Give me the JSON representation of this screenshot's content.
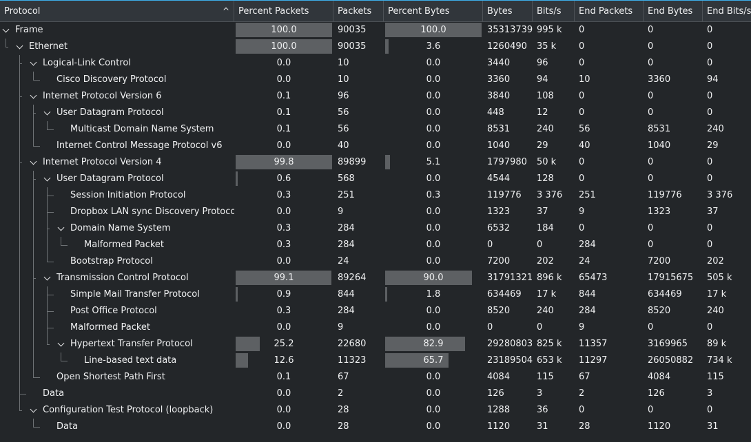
{
  "columns": [
    {
      "key": "protocol",
      "label": "Protocol"
    },
    {
      "key": "pct_packets",
      "label": "Percent Packets"
    },
    {
      "key": "packets",
      "label": "Packets"
    },
    {
      "key": "pct_bytes",
      "label": "Percent Bytes"
    },
    {
      "key": "bytes",
      "label": "Bytes"
    },
    {
      "key": "bits_s",
      "label": "Bits/s"
    },
    {
      "key": "end_packets",
      "label": "End Packets"
    },
    {
      "key": "end_bytes",
      "label": "End Bytes"
    },
    {
      "key": "end_bits_s",
      "label": "End Bits/s"
    }
  ],
  "sort_indicator": {
    "column": "protocol",
    "icon": "chevron-up-icon"
  },
  "rows": [
    {
      "depth": 0,
      "expanded": true,
      "name": "Frame",
      "pct_packets": "100.0",
      "packets": "90035",
      "pct_bytes": "100.0",
      "bytes": "35313739",
      "bits_s": "995 k",
      "end_packets": "0",
      "end_bytes": "0",
      "end_bits_s": "0"
    },
    {
      "depth": 1,
      "expanded": true,
      "name": "Ethernet",
      "pct_packets": "100.0",
      "packets": "90035",
      "pct_bytes": "3.6",
      "bytes": "1260490",
      "bits_s": "35 k",
      "end_packets": "0",
      "end_bytes": "0",
      "end_bits_s": "0"
    },
    {
      "depth": 2,
      "expanded": true,
      "name": "Logical-Link Control",
      "pct_packets": "0.0",
      "packets": "10",
      "pct_bytes": "0.0",
      "bytes": "3440",
      "bits_s": "96",
      "end_packets": "0",
      "end_bytes": "0",
      "end_bits_s": "0"
    },
    {
      "depth": 3,
      "expanded": false,
      "name": "Cisco Discovery Protocol",
      "pct_packets": "0.0",
      "packets": "10",
      "pct_bytes": "0.0",
      "bytes": "3360",
      "bits_s": "94",
      "end_packets": "10",
      "end_bytes": "3360",
      "end_bits_s": "94"
    },
    {
      "depth": 2,
      "expanded": true,
      "name": "Internet Protocol Version 6",
      "pct_packets": "0.1",
      "packets": "96",
      "pct_bytes": "0.0",
      "bytes": "3840",
      "bits_s": "108",
      "end_packets": "0",
      "end_bytes": "0",
      "end_bits_s": "0"
    },
    {
      "depth": 3,
      "expanded": true,
      "name": "User Datagram Protocol",
      "pct_packets": "0.1",
      "packets": "56",
      "pct_bytes": "0.0",
      "bytes": "448",
      "bits_s": "12",
      "end_packets": "0",
      "end_bytes": "0",
      "end_bits_s": "0"
    },
    {
      "depth": 4,
      "expanded": false,
      "name": "Multicast Domain Name System",
      "pct_packets": "0.1",
      "packets": "56",
      "pct_bytes": "0.0",
      "bytes": "8531",
      "bits_s": "240",
      "end_packets": "56",
      "end_bytes": "8531",
      "end_bits_s": "240"
    },
    {
      "depth": 3,
      "expanded": false,
      "name": "Internet Control Message Protocol v6",
      "pct_packets": "0.0",
      "packets": "40",
      "pct_bytes": "0.0",
      "bytes": "1040",
      "bits_s": "29",
      "end_packets": "40",
      "end_bytes": "1040",
      "end_bits_s": "29"
    },
    {
      "depth": 2,
      "expanded": true,
      "name": "Internet Protocol Version 4",
      "pct_packets": "99.8",
      "packets": "89899",
      "pct_bytes": "5.1",
      "bytes": "1797980",
      "bits_s": "50 k",
      "end_packets": "0",
      "end_bytes": "0",
      "end_bits_s": "0"
    },
    {
      "depth": 3,
      "expanded": true,
      "name": "User Datagram Protocol",
      "pct_packets": "0.6",
      "packets": "568",
      "pct_bytes": "0.0",
      "bytes": "4544",
      "bits_s": "128",
      "end_packets": "0",
      "end_bytes": "0",
      "end_bits_s": "0"
    },
    {
      "depth": 4,
      "expanded": false,
      "name": "Session Initiation Protocol",
      "pct_packets": "0.3",
      "packets": "251",
      "pct_bytes": "0.3",
      "bytes": "119776",
      "bits_s": "3 376",
      "end_packets": "251",
      "end_bytes": "119776",
      "end_bits_s": "3 376"
    },
    {
      "depth": 4,
      "expanded": false,
      "name": "Dropbox LAN sync Discovery Protocol",
      "pct_packets": "0.0",
      "packets": "9",
      "pct_bytes": "0.0",
      "bytes": "1323",
      "bits_s": "37",
      "end_packets": "9",
      "end_bytes": "1323",
      "end_bits_s": "37"
    },
    {
      "depth": 4,
      "expanded": true,
      "name": "Domain Name System",
      "pct_packets": "0.3",
      "packets": "284",
      "pct_bytes": "0.0",
      "bytes": "6532",
      "bits_s": "184",
      "end_packets": "0",
      "end_bytes": "0",
      "end_bits_s": "0"
    },
    {
      "depth": 5,
      "expanded": false,
      "name": "Malformed Packet",
      "pct_packets": "0.3",
      "packets": "284",
      "pct_bytes": "0.0",
      "bytes": "0",
      "bits_s": "0",
      "end_packets": "284",
      "end_bytes": "0",
      "end_bits_s": "0"
    },
    {
      "depth": 4,
      "expanded": false,
      "name": "Bootstrap Protocol",
      "pct_packets": "0.0",
      "packets": "24",
      "pct_bytes": "0.0",
      "bytes": "7200",
      "bits_s": "202",
      "end_packets": "24",
      "end_bytes": "7200",
      "end_bits_s": "202"
    },
    {
      "depth": 3,
      "expanded": true,
      "name": "Transmission Control Protocol",
      "pct_packets": "99.1",
      "packets": "89264",
      "pct_bytes": "90.0",
      "bytes": "31791321",
      "bits_s": "896 k",
      "end_packets": "65473",
      "end_bytes": "17915675",
      "end_bits_s": "505 k"
    },
    {
      "depth": 4,
      "expanded": false,
      "name": "Simple Mail Transfer Protocol",
      "pct_packets": "0.9",
      "packets": "844",
      "pct_bytes": "1.8",
      "bytes": "634469",
      "bits_s": "17 k",
      "end_packets": "844",
      "end_bytes": "634469",
      "end_bits_s": "17 k"
    },
    {
      "depth": 4,
      "expanded": false,
      "name": "Post Office Protocol",
      "pct_packets": "0.3",
      "packets": "284",
      "pct_bytes": "0.0",
      "bytes": "8520",
      "bits_s": "240",
      "end_packets": "284",
      "end_bytes": "8520",
      "end_bits_s": "240"
    },
    {
      "depth": 4,
      "expanded": false,
      "name": "Malformed Packet",
      "pct_packets": "0.0",
      "packets": "9",
      "pct_bytes": "0.0",
      "bytes": "0",
      "bits_s": "0",
      "end_packets": "9",
      "end_bytes": "0",
      "end_bits_s": "0"
    },
    {
      "depth": 4,
      "expanded": true,
      "name": "Hypertext Transfer Protocol",
      "pct_packets": "25.2",
      "packets": "22680",
      "pct_bytes": "82.9",
      "bytes": "29280803",
      "bits_s": "825 k",
      "end_packets": "11357",
      "end_bytes": "3169965",
      "end_bits_s": "89 k"
    },
    {
      "depth": 5,
      "expanded": false,
      "name": "Line-based text data",
      "pct_packets": "12.6",
      "packets": "11323",
      "pct_bytes": "65.7",
      "bytes": "23189504",
      "bits_s": "653 k",
      "end_packets": "11297",
      "end_bytes": "26050882",
      "end_bits_s": "734 k"
    },
    {
      "depth": 3,
      "expanded": false,
      "name": "Open Shortest Path First",
      "pct_packets": "0.1",
      "packets": "67",
      "pct_bytes": "0.0",
      "bytes": "4084",
      "bits_s": "115",
      "end_packets": "67",
      "end_bytes": "4084",
      "end_bits_s": "115"
    },
    {
      "depth": 2,
      "expanded": false,
      "name": "Data",
      "pct_packets": "0.0",
      "packets": "2",
      "pct_bytes": "0.0",
      "bytes": "126",
      "bits_s": "3",
      "end_packets": "2",
      "end_bytes": "126",
      "end_bits_s": "3"
    },
    {
      "depth": 2,
      "expanded": true,
      "name": "Configuration Test Protocol (loopback)",
      "pct_packets": "0.0",
      "packets": "28",
      "pct_bytes": "0.0",
      "bytes": "1288",
      "bits_s": "36",
      "end_packets": "0",
      "end_bytes": "0",
      "end_bits_s": "0"
    },
    {
      "depth": 3,
      "expanded": false,
      "name": "Data",
      "pct_packets": "0.0",
      "packets": "28",
      "pct_bytes": "0.0",
      "bytes": "1120",
      "bits_s": "31",
      "end_packets": "28",
      "end_bytes": "1120",
      "end_bits_s": "31"
    }
  ]
}
